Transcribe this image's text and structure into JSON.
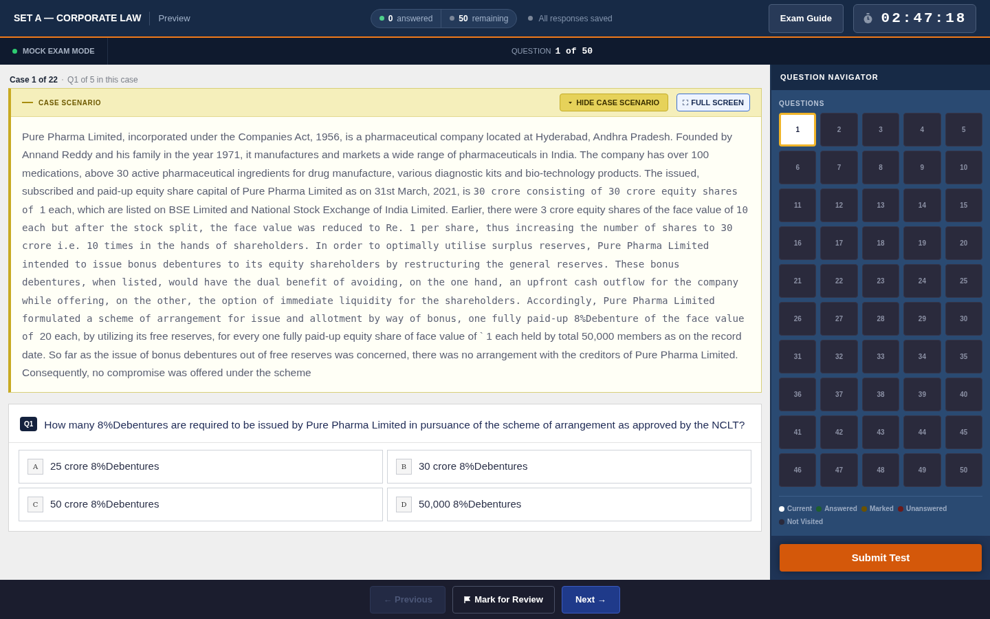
{
  "header": {
    "title": "SET A — CORPORATE LAW",
    "subtitle": "Preview",
    "answered_count": "0",
    "answered_label": "answered",
    "remaining_count": "50",
    "remaining_label": "remaining",
    "save_status": "All responses saved",
    "guide_button": "Exam Guide",
    "timer": "02:47:18"
  },
  "mode_bar": {
    "mode": "MOCK EXAM MODE",
    "question_label": "QUESTION",
    "question_position": "1 of 50"
  },
  "case_info": {
    "case": "Case 1 of 22",
    "position": "Q1 of 5 in this case"
  },
  "scenario": {
    "title": "CASE SCENARIO",
    "hide_button": "HIDE CASE SCENARIO",
    "fullscreen_button": "FULL SCREEN",
    "segments": [
      {
        "kind": "sans",
        "text": "Pure Pharma Limited, incorporated under the Companies Act, 1956, is a pharmaceutical company located at Hyderabad, Andhra Pradesh. Founded by Annand Reddy and his family in the year 1971, it manufactures and markets a wide range of pharmaceuticals in India. The company has over 100 medications, above 30 active pharmaceutical ingredients for drug manufacture, various diagnostic kits and bio-technology products. The issued, subscribed and paid-up equity share capital of Pure Pharma Limited as on 31st March, 2021, is "
      },
      {
        "kind": "mono",
        "text": "30 crore consisting of 30 crore equity shares of "
      },
      {
        "kind": "sans",
        "text": " 1 each, which are listed on BSE Limited and National Stock Exchange of India Limited. Earlier, there were 3 crore equity shares of the face value of "
      },
      {
        "kind": "mono",
        "text": "10 each but after the stock split, the face value was reduced to Re. 1 per share, thus increasing the number of shares to 30 crore i.e. 10 times in the hands of shareholders. In order to optimally utilise surplus reserves, Pure Pharma Limited intended to issue bonus debentures to its equity shareholders by restructuring the general reserves. These bonus debentures, when listed, would have the dual benefit of avoiding, on the one hand, an upfront cash outflow for the company while offering, on the other, the option of immediate liquidity for the shareholders. Accordingly, Pure Pharma Limited formulated a scheme of arrangement for issue and allotment by way of bonus, one fully paid-up 8%Debenture of the face value of "
      },
      {
        "kind": "sans",
        "text": " 20 each, by utilizing its free reserves, for every one fully paid-up equity share of face value of ` 1 each held by total 50,000 members as on the record date. So far as the issue of bonus debentures out of free reserves was concerned, there was no arrangement with the creditors of Pure Pharma Limited. Consequently, no compromise was offered under the scheme"
      }
    ]
  },
  "question": {
    "number": "Q1",
    "text": "How many 8%Debentures are required to be issued by Pure Pharma Limited in pursuance of the scheme of arrangement as approved by the NCLT?",
    "options": [
      {
        "letter": "A",
        "text": "25 crore 8%Debentures",
        "selected": false
      },
      {
        "letter": "B",
        "text": "30 crore 8%Debentures",
        "selected": false
      },
      {
        "letter": "C",
        "text": "50 crore 8%Debentures",
        "selected": false
      },
      {
        "letter": "D",
        "text": "50,000 8%Debentures",
        "selected": false
      }
    ]
  },
  "navigator": {
    "title": "QUESTION NAVIGATOR",
    "section": "QUESTIONS",
    "questions": [
      {
        "label": "1",
        "selected": true
      },
      {
        "label": "2",
        "selected": false
      },
      {
        "label": "3",
        "selected": false
      },
      {
        "label": "4",
        "selected": false
      },
      {
        "label": "5",
        "selected": false
      },
      {
        "label": "6",
        "selected": false
      },
      {
        "label": "7",
        "selected": false
      },
      {
        "label": "8",
        "selected": false
      },
      {
        "label": "9",
        "selected": false
      },
      {
        "label": "10",
        "selected": false
      },
      {
        "label": "11",
        "selected": false
      },
      {
        "label": "12",
        "selected": false
      },
      {
        "label": "13",
        "selected": false
      },
      {
        "label": "14",
        "selected": false
      },
      {
        "label": "15",
        "selected": false
      },
      {
        "label": "16",
        "selected": false
      },
      {
        "label": "17",
        "selected": false
      },
      {
        "label": "18",
        "selected": false
      },
      {
        "label": "19",
        "selected": false
      },
      {
        "label": "20",
        "selected": false
      },
      {
        "label": "21",
        "selected": false
      },
      {
        "label": "22",
        "selected": false
      },
      {
        "label": "23",
        "selected": false
      },
      {
        "label": "24",
        "selected": false
      },
      {
        "label": "25",
        "selected": false
      },
      {
        "label": "26",
        "selected": false
      },
      {
        "label": "27",
        "selected": false
      },
      {
        "label": "28",
        "selected": false
      },
      {
        "label": "29",
        "selected": false
      },
      {
        "label": "30",
        "selected": false
      },
      {
        "label": "31",
        "selected": false
      },
      {
        "label": "32",
        "selected": false
      },
      {
        "label": "33",
        "selected": false
      },
      {
        "label": "34",
        "selected": false
      },
      {
        "label": "35",
        "selected": false
      },
      {
        "label": "36",
        "selected": false
      },
      {
        "label": "37",
        "selected": false
      },
      {
        "label": "38",
        "selected": false
      },
      {
        "label": "39",
        "selected": false
      },
      {
        "label": "40",
        "selected": false
      },
      {
        "label": "41",
        "selected": false
      },
      {
        "label": "42",
        "selected": false
      },
      {
        "label": "43",
        "selected": false
      },
      {
        "label": "44",
        "selected": false
      },
      {
        "label": "45",
        "selected": false
      },
      {
        "label": "46",
        "selected": false
      },
      {
        "label": "47",
        "selected": false
      },
      {
        "label": "48",
        "selected": false
      },
      {
        "label": "49",
        "selected": false
      },
      {
        "label": "50",
        "selected": false
      }
    ],
    "legend": [
      {
        "label": "Current",
        "color": "#ffffff"
      },
      {
        "label": "Answered",
        "color": "#1e5e2e"
      },
      {
        "label": "Marked",
        "color": "#6b5200"
      },
      {
        "label": "Unanswered",
        "color": "#6b1a1a"
      },
      {
        "label": "Not Visited",
        "color": "#2a2a3c"
      }
    ],
    "submit_button": "Submit Test"
  },
  "footer": {
    "previous_button": "← Previous",
    "previous_disabled": true,
    "review_button": "Mark for Review",
    "next_button": "Next →"
  }
}
